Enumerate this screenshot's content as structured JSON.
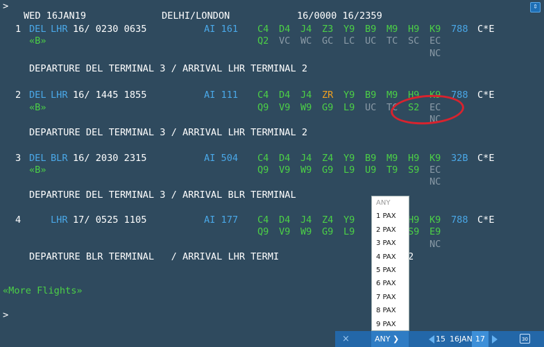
{
  "prompt": ">",
  "prompt2": ">",
  "header": {
    "day": "WED 16JAN19",
    "route": "DELHI/LONDON",
    "range": "16/0000 16/2359"
  },
  "flights": [
    {
      "num": "1",
      "org": "DEL",
      "dst": "LHR",
      "date_time": "16/ 0230 0635",
      "flight": "AI 161",
      "row1": {
        "C4": "C4",
        "D4": "D4",
        "J4": "J4",
        "Z": "Z3",
        "Y9": "Y9",
        "B9": "B9",
        "M9": "M9",
        "H9": "H9",
        "K9": "K9"
      },
      "equip": "788",
      "meal": "C*E",
      "tag": "«B»",
      "row2": {
        "a": "Q2",
        "b": "VC",
        "c": "WC",
        "d": "GC",
        "e": "LC",
        "f": "UC",
        "g": "TC",
        "h": "SC",
        "i": "EC"
      },
      "row3": "NC",
      "info": "DEPARTURE DEL TERMINAL 3 / ARRIVAL LHR TERMINAL 2"
    },
    {
      "num": "2",
      "org": "DEL",
      "dst": "LHR",
      "date_time": "16/ 1445 1855",
      "flight": "AI 111",
      "row1": {
        "C4": "C4",
        "D4": "D4",
        "J4": "J4",
        "Z": "ZR",
        "Y9": "Y9",
        "B9": "B9",
        "M9": "M9",
        "H9": "H9",
        "K9": "K9"
      },
      "equip": "788",
      "meal": "C*E",
      "tag": "«B»",
      "row2": {
        "a": "Q9",
        "b": "V9",
        "c": "W9",
        "d": "G9",
        "e": "L9",
        "f": "UC",
        "g": "TC",
        "h": "S2",
        "i": "EC"
      },
      "row3": "NC",
      "info": "DEPARTURE DEL TERMINAL 3 / ARRIVAL LHR TERMINAL 2"
    },
    {
      "num": "3",
      "org": "DEL",
      "dst": "BLR",
      "date_time": "16/ 2030 2315",
      "flight": "AI 504",
      "row1": {
        "C4": "C4",
        "D4": "D4",
        "J4": "J4",
        "Z": "Z4",
        "Y9": "Y9",
        "B9": "B9",
        "M9": "M9",
        "H9": "H9",
        "K9": "K9"
      },
      "equip": "32B",
      "meal": "C*E",
      "tag": "«B»",
      "row2": {
        "a": "Q9",
        "b": "V9",
        "c": "W9",
        "d": "G9",
        "e": "L9",
        "f": "U9",
        "g": "T9",
        "h": "S9",
        "i": "EC"
      },
      "row3": "NC",
      "info": "DEPARTURE DEL TERMINAL 3 / ARRIVAL BLR TERMINAL"
    },
    {
      "num": "4",
      "org": "",
      "dst": "LHR",
      "date_time": "17/ 0525 1105",
      "flight": "AI 177",
      "row1": {
        "C4": "C4",
        "D4": "D4",
        "J4": "J4",
        "Z": "Z4",
        "Y9": "Y9",
        "B9": "",
        "M9": "",
        "H9": "H9",
        "K9": "K9"
      },
      "equip": "788",
      "meal": "C*E",
      "tag": "",
      "row2": {
        "a": "Q9",
        "b": "V9",
        "c": "W9",
        "d": "G9",
        "e": "L9",
        "f": "",
        "g": "",
        "h": "S9",
        "i": "E9"
      },
      "row3": "NC",
      "info_a": "DEPARTURE BLR TERMINAL   / ARRIVAL LHR TERMI",
      "info_b": "2"
    }
  ],
  "more_flights": "«More Flights»",
  "dropdown": {
    "options": [
      "ANY",
      "1 PAX",
      "2 PAX",
      "3 PAX",
      "4 PAX",
      "5 PAX",
      "6 PAX",
      "7 PAX",
      "8 PAX",
      "9 PAX"
    ]
  },
  "bottom_bar": {
    "close_icon": "×",
    "pax_selected": "ANY ❯",
    "d15": "15",
    "date": "16JAN",
    "d17": "17",
    "cal_icon": "30"
  }
}
